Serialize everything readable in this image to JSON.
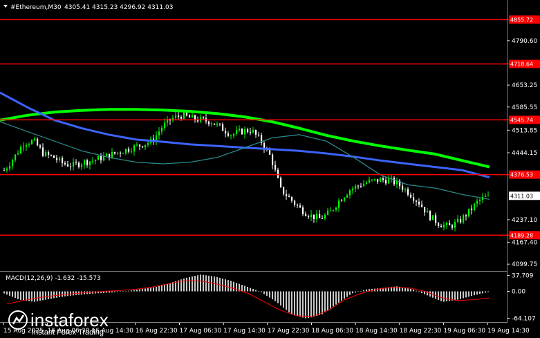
{
  "header": {
    "symbol": "#Ethereum,M30",
    "ohlc": "4305.41 4315.23 4296.92 4311.03"
  },
  "watermark": {
    "brand": "instaforex",
    "tagline": "Instant Forex Trading"
  },
  "colors": {
    "background": "#000000",
    "bull": "#00ff00",
    "bear": "#ffffff",
    "level_line": "#ff0000",
    "ma_green": "#00ff00",
    "ma_blue": "#3c64ff",
    "ma_teal": "#2b8a8a",
    "macd_hist": "#c8c8c8",
    "macd_signal": "#ff0000"
  },
  "chart_data": {
    "type": "candlestick",
    "symbol": "#Ethereum",
    "timeframe": "M30",
    "ylim": [
      4083,
      4880
    ],
    "y_ticks": [
      "4790.60",
      "4653.25",
      "4585.55",
      "4513.85",
      "4444.15",
      "4237.10",
      "4167.40",
      "4099.75"
    ],
    "x_labels": [
      "15 Aug 2025",
      "16 Aug 06:30",
      "16 Aug 14:30",
      "16 Aug 22:30",
      "17 Aug 06:30",
      "17 Aug 14:30",
      "17 Aug 22:30",
      "18 Aug 06:30",
      "18 Aug 14:30",
      "18 Aug 22:30",
      "19 Aug 06:30",
      "19 Aug 14:30"
    ],
    "levels": [
      {
        "value": 4855.72,
        "label": "4855.72"
      },
      {
        "value": 4718.64,
        "label": "4718.64"
      },
      {
        "value": 4545.74,
        "label": "4545.74"
      },
      {
        "value": 4376.53,
        "label": "4376.53"
      },
      {
        "value": 4189.28,
        "label": "4189.28"
      }
    ],
    "last_price": {
      "value": 4311.03,
      "label": "4311.03"
    },
    "price_path": [
      4390,
      4430,
      4475,
      4480,
      4440,
      4430,
      4410,
      4405,
      4415,
      4420,
      4430,
      4440,
      4450,
      4460,
      4470,
      4480,
      4525,
      4550,
      4560,
      4550,
      4545,
      4540,
      4520,
      4500,
      4510,
      4515,
      4480,
      4430,
      4330,
      4300,
      4270,
      4250,
      4240,
      4260,
      4300,
      4330,
      4345,
      4355,
      4360,
      4360,
      4345,
      4320,
      4290,
      4250,
      4225,
      4215,
      4230,
      4260,
      4295,
      4311.03
    ],
    "moving_averages": [
      {
        "color": "green",
        "values": [
          4545,
          4560,
          4570,
          4575,
          4578,
          4578,
          4576,
          4572,
          4565,
          4555,
          4540,
          4520,
          4498,
          4480,
          4465,
          4452,
          4440,
          4420,
          4400
        ]
      },
      {
        "color": "blue",
        "values": [
          4630,
          4585,
          4545,
          4520,
          4500,
          4485,
          4478,
          4470,
          4465,
          4460,
          4455,
          4450,
          4442,
          4432,
          4420,
          4410,
          4400,
          4390,
          4368
        ]
      },
      {
        "color": "teal",
        "values": [
          4540,
          4510,
          4480,
          4450,
          4430,
          4415,
          4410,
          4415,
          4430,
          4460,
          4490,
          4500,
          4480,
          4430,
          4375,
          4345,
          4335,
          4315,
          4300
        ]
      }
    ],
    "macd": {
      "label": "MACD(12,26,9) -1.632 -15.573",
      "y_ticks": [
        "37.709",
        "0.00",
        "-64.107"
      ],
      "ylim": [
        -70,
        42
      ],
      "histogram_path": [
        -5,
        -20,
        -25,
        -18,
        -12,
        -8,
        -5,
        -3,
        0,
        5,
        10,
        20,
        32,
        40,
        35,
        25,
        12,
        -2,
        -25,
        -55,
        -65,
        -55,
        -30,
        -5,
        5,
        8,
        12,
        5,
        -10,
        -25,
        -20,
        -10,
        -1.632
      ],
      "signal_path": [
        -30,
        -22,
        -15,
        -10,
        -6,
        -3,
        0,
        2,
        5,
        10,
        18,
        25,
        25,
        18,
        8,
        -5,
        -25,
        -45,
        -58,
        -60,
        -45,
        -20,
        -5,
        5,
        10,
        8,
        0,
        -15,
        -22,
        -20,
        -15.573
      ]
    }
  }
}
